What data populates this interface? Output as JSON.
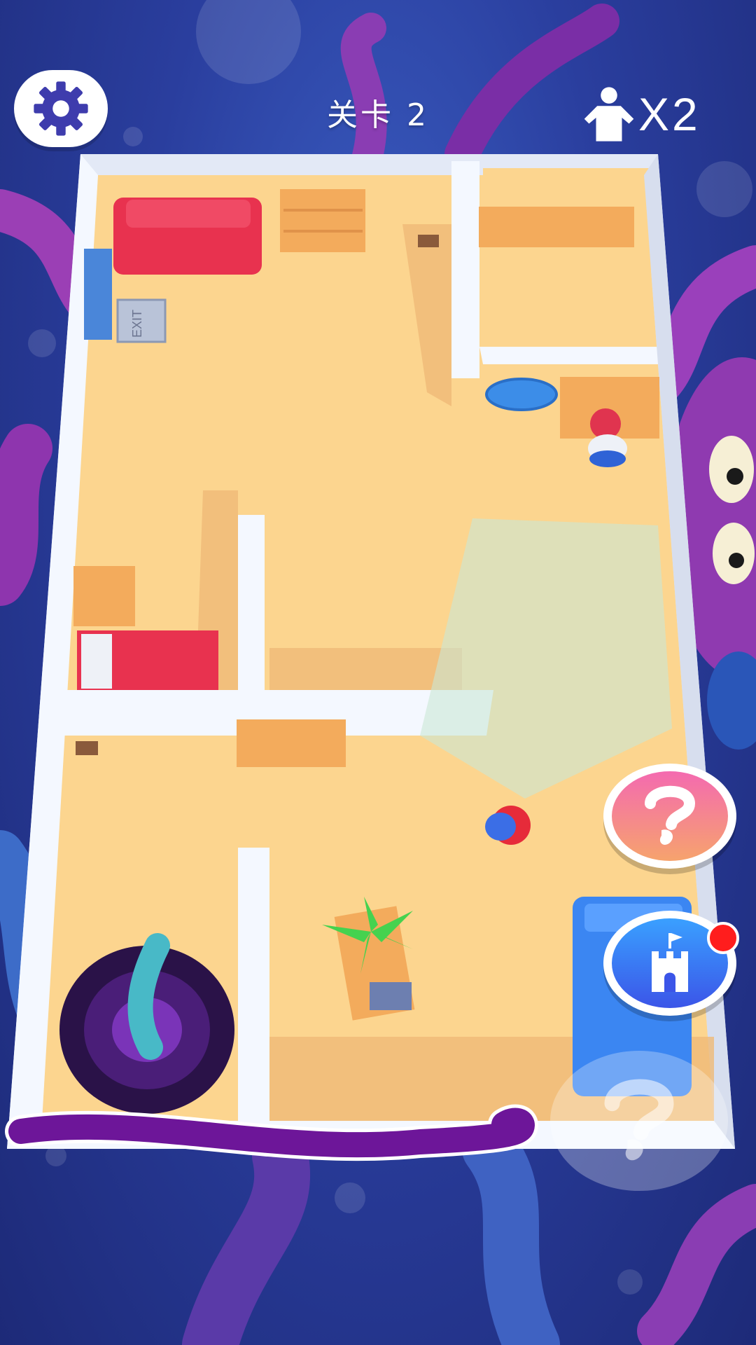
{
  "hud": {
    "level_label": "关卡 2",
    "lives_prefix": "X",
    "lives_count": "2"
  },
  "icons": {
    "settings": "gear-icon",
    "player": "person-icon",
    "hint": "question-icon",
    "castle": "castle-icon"
  },
  "colors": {
    "background": "#2a3e9e",
    "floor": "#fcd58f",
    "wall": "#f4f8ff",
    "sofa": "#e8324f",
    "furniture": "#f3ab5c",
    "tentacle": "#8a2fa3",
    "hint_button": "#f46ab0",
    "castle_button": "#3b55e8",
    "notification": "#ff1d1d"
  }
}
